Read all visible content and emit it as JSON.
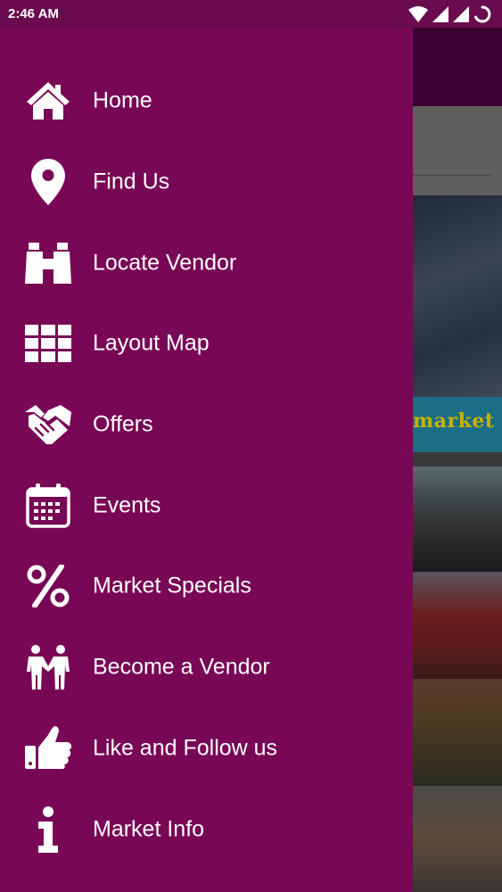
{
  "status_bar": {
    "time": "2:46 AM",
    "icons": [
      "wifi-icon",
      "signal-icon",
      "signal-icon",
      "loading-icon"
    ]
  },
  "background": {
    "banner_text": "market"
  },
  "drawer": {
    "background_color": "#780755",
    "items": [
      {
        "label": "Home",
        "icon": "home-icon"
      },
      {
        "label": "Find Us",
        "icon": "location-pin-icon"
      },
      {
        "label": "Locate Vendor",
        "icon": "binoculars-icon"
      },
      {
        "label": "Layout Map",
        "icon": "grid-icon"
      },
      {
        "label": "Offers",
        "icon": "handshake-icon"
      },
      {
        "label": "Events",
        "icon": "calendar-icon"
      },
      {
        "label": "Market Specials",
        "icon": "percent-icon"
      },
      {
        "label": "Become a Vendor",
        "icon": "people-icon"
      },
      {
        "label": "Like and Follow us",
        "icon": "thumbs-up-icon"
      },
      {
        "label": "Market Info",
        "icon": "info-icon"
      }
    ]
  }
}
